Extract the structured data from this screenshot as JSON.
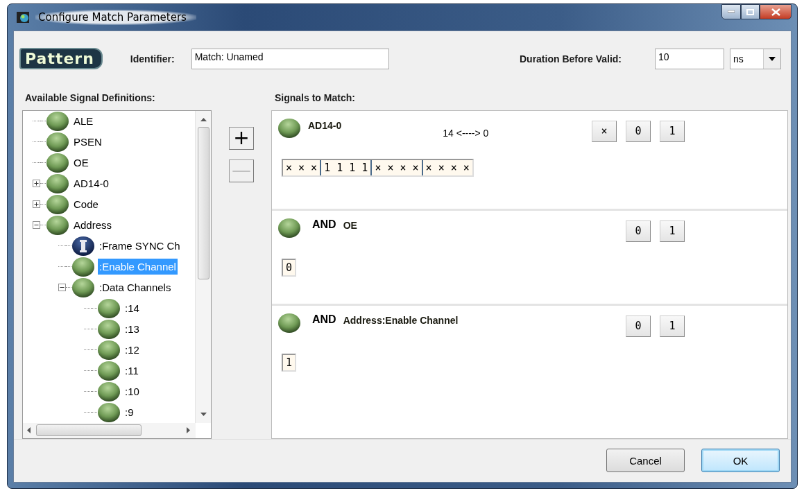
{
  "window": {
    "title": "Configure Match Parameters"
  },
  "header": {
    "badge": "Pattern",
    "identifier_label": "Identifier:",
    "identifier_value": "Match: Unamed",
    "duration_label": "Duration Before Valid:",
    "duration_value": "10",
    "unit": "ns"
  },
  "tree": {
    "label": "Available Signal Definitions:",
    "items": [
      {
        "label": "ALE",
        "kind": "signal",
        "selected": false
      },
      {
        "label": "PSEN",
        "kind": "signal",
        "selected": false
      },
      {
        "label": "OE",
        "kind": "signal",
        "selected": false
      },
      {
        "label": "AD14-0",
        "kind": "signal",
        "selected": false,
        "expanded": false
      },
      {
        "label": "Code",
        "kind": "signal",
        "selected": false,
        "expanded": false
      },
      {
        "label": "Address",
        "kind": "signal",
        "selected": false,
        "expanded": true,
        "children": [
          {
            "label": ":Frame SYNC Ch",
            "kind": "info",
            "selected": false
          },
          {
            "label": ":Enable Channel",
            "kind": "signal",
            "selected": true
          },
          {
            "label": ":Data Channels",
            "kind": "signal",
            "selected": false,
            "expanded": true,
            "children": [
              {
                "label": ":14",
                "kind": "signal",
                "selected": false
              },
              {
                "label": ":13",
                "kind": "signal",
                "selected": false
              },
              {
                "label": ":12",
                "kind": "signal",
                "selected": false
              },
              {
                "label": ":11",
                "kind": "signal",
                "selected": false
              },
              {
                "label": ":10",
                "kind": "signal",
                "selected": false
              },
              {
                "label": ":9",
                "kind": "signal",
                "selected": false
              }
            ]
          }
        ]
      }
    ]
  },
  "move_buttons": [
    {
      "label": "+",
      "disabled": false
    },
    {
      "label": "—",
      "disabled": true
    }
  ],
  "signals": {
    "label": "Signals to Match:",
    "conditions": [
      {
        "name": "AD14-0",
        "range": "14 <----> 0",
        "bit_groups": [
          "× × ×",
          "1 1 1 1",
          "× × × ×",
          "× × × ×"
        ],
        "buttons": [
          "×",
          "0",
          "1"
        ]
      },
      {
        "operator": "AND",
        "name": "OE",
        "bit_groups": [
          "0"
        ],
        "buttons": [
          "0",
          "1"
        ]
      },
      {
        "operator": "AND",
        "name": "Address:Enable Channel",
        "bit_groups": [
          "1"
        ],
        "buttons": [
          "0",
          "1"
        ]
      }
    ]
  },
  "footer": {
    "buttons": [
      {
        "label": "Cancel",
        "default": false
      },
      {
        "label": "OK",
        "default": true
      }
    ]
  }
}
